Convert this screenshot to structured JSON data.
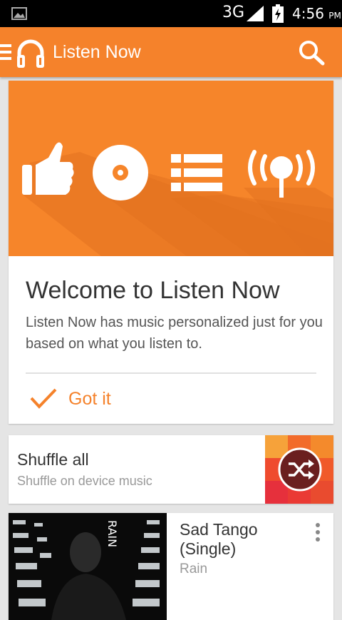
{
  "status_bar": {
    "network": "3G",
    "time": "4:56",
    "ampm": "PM"
  },
  "app_bar": {
    "title": "Listen Now",
    "icons": [
      "menu-icon",
      "headphones-logo-icon",
      "search-icon"
    ]
  },
  "welcome_card": {
    "hero_icons": [
      "thumbs-up-icon",
      "disc-icon",
      "list-icon",
      "radio-icon"
    ],
    "heading": "Welcome to Listen Now",
    "description": "Listen Now has music personalized just for you based on what you listen to.",
    "dismiss_label": "Got it"
  },
  "shuffle_card": {
    "title": "Shuffle all",
    "subtitle": "Shuffle on device music"
  },
  "album_card": {
    "title": "Sad Tango (Single)",
    "artist": "Rain",
    "cover_text": "RAIN"
  },
  "colors": {
    "accent": "#f5822b",
    "status_bar": "#000000",
    "background": "#e5e5e5"
  }
}
